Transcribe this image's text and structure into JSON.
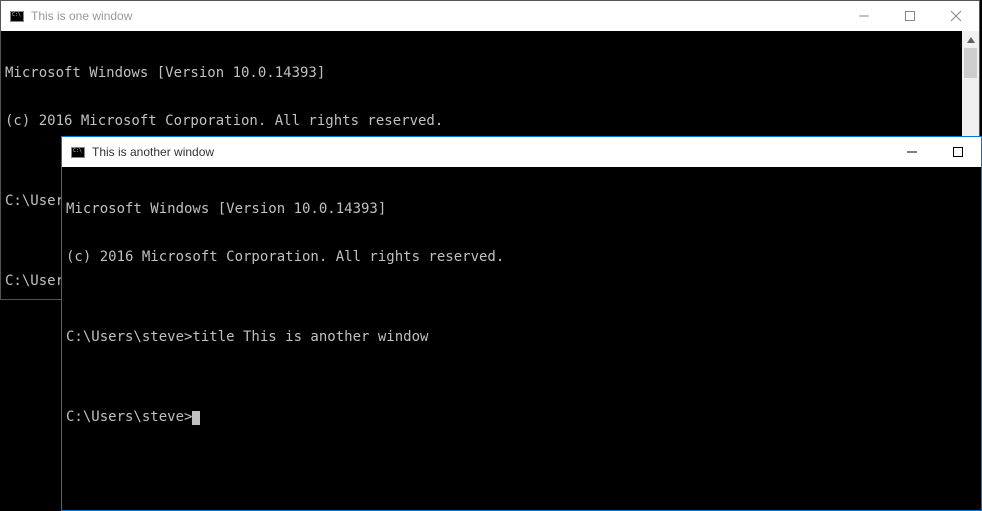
{
  "window1": {
    "title": "This is one window",
    "lines": [
      "Microsoft Windows [Version 10.0.14393]",
      "(c) 2016 Microsoft Corporation. All rights reserved.",
      "",
      "C:\\Users\\steve>title This is one window",
      "",
      "C:\\Users\\steve>"
    ]
  },
  "window2": {
    "title": "This is another window",
    "lines": [
      "Microsoft Windows [Version 10.0.14393]",
      "(c) 2016 Microsoft Corporation. All rights reserved.",
      "",
      "C:\\Users\\steve>title This is another window",
      "",
      "C:\\Users\\steve>"
    ]
  }
}
